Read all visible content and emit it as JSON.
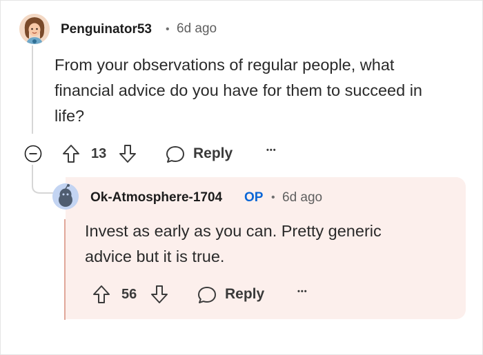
{
  "parent_comment": {
    "username": "Penguinator53",
    "separator": "•",
    "time": "6d ago",
    "text_lines": [
      "From your observations of regular people, what",
      "financial advice do you have for them to succeed in",
      "life?"
    ],
    "upvotes": "13",
    "reply_label": "Reply",
    "more_label": "•••",
    "collapse_symbol": "−"
  },
  "reply_comment": {
    "username": "Ok-Atmosphere-1704",
    "op_badge": "OP",
    "separator": "•",
    "time": "6d ago",
    "text_lines": [
      "Invest as early as you can. Pretty generic",
      "advice but it is true."
    ],
    "upvotes": "56",
    "reply_label": "Reply",
    "more_label": "•••"
  },
  "colors": {
    "reply_background": "#fcefec",
    "op_badge": "#0a66d6",
    "thread_line": "#d6d6d6",
    "reply_accent_line": "#e0a799"
  },
  "icons": {
    "parent_avatar": "cartoon-girl-avatar",
    "reply_avatar": "reddit-snoo-avatar",
    "upvote": "arrow-up-outline-icon",
    "downvote": "arrow-down-outline-icon",
    "reply": "speech-bubble-icon",
    "collapse": "minus-circle-icon"
  }
}
